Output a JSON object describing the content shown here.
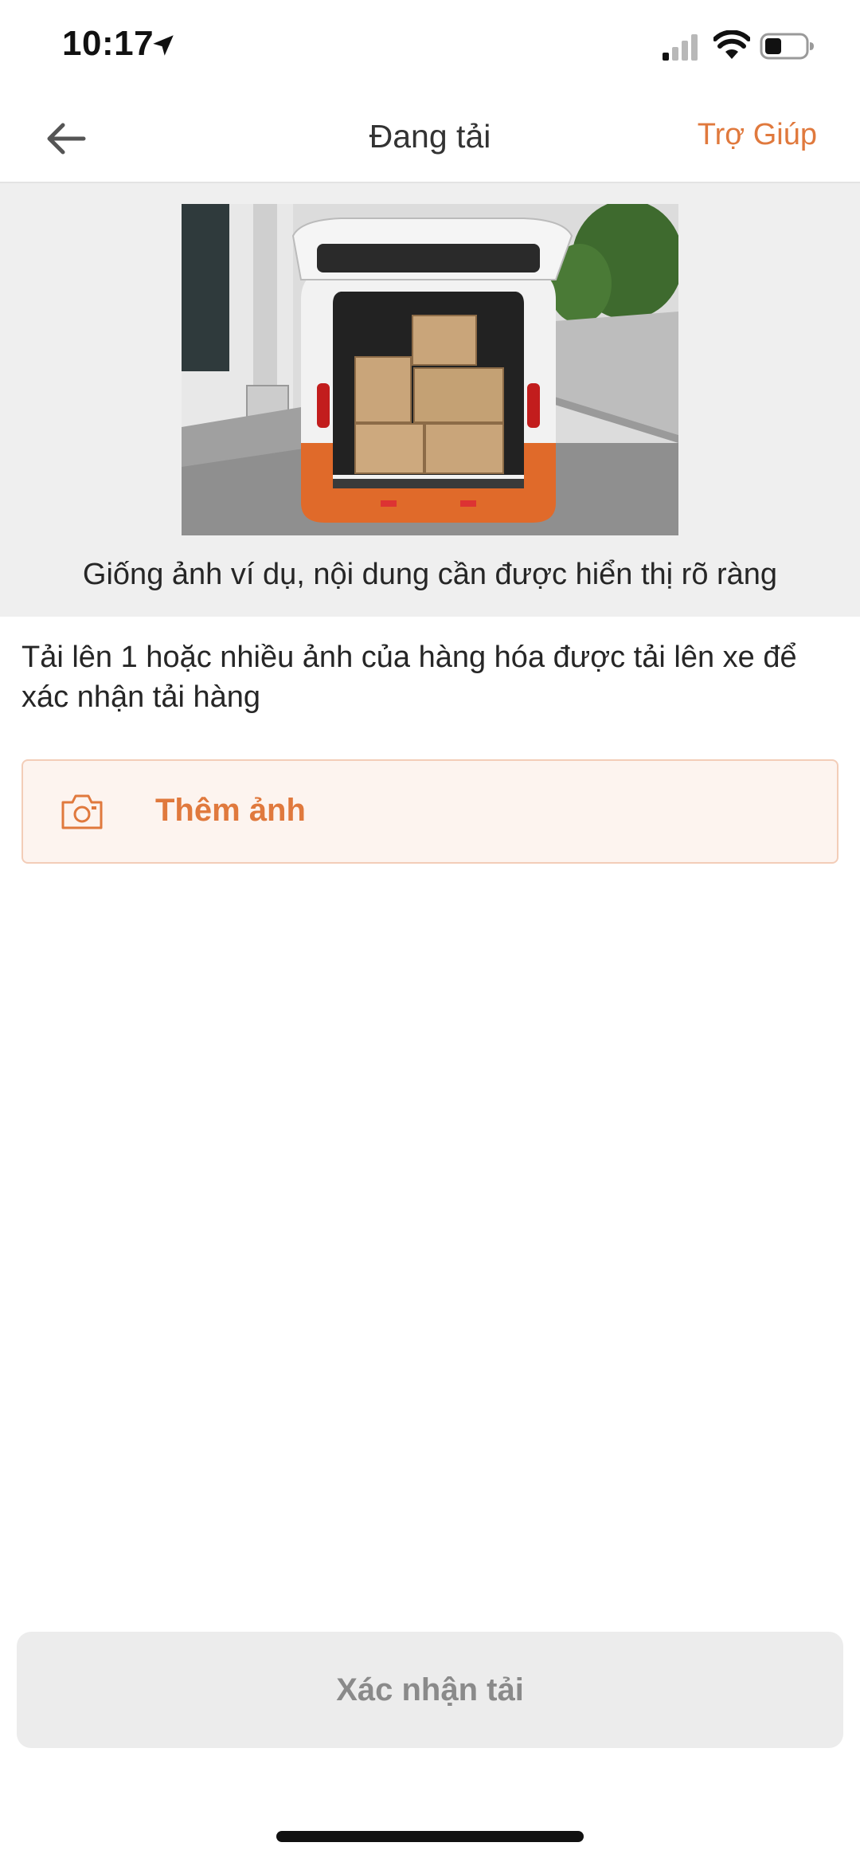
{
  "status_bar": {
    "time": "10:17"
  },
  "nav": {
    "title": "Đang tải",
    "help": "Trợ Giúp"
  },
  "example": {
    "caption": "Giống ảnh ví dụ, nội dung cần được hiển thị rõ ràng"
  },
  "instruction": "Tải lên 1 hoặc nhiều ảnh của hàng hóa được tải lên xe để xác nhận tải hàng",
  "add_photo": {
    "label": "Thêm ảnh"
  },
  "confirm": {
    "label": "Xác nhận tải"
  },
  "colors": {
    "accent": "#e0793d",
    "panel": "#efefef",
    "disabled_button": "#ececec"
  },
  "icons": {
    "back": "arrow-left-icon",
    "camera": "camera-icon",
    "location": "location-arrow-icon",
    "signal": "cellular-signal-icon",
    "wifi": "wifi-icon",
    "battery": "battery-icon"
  }
}
